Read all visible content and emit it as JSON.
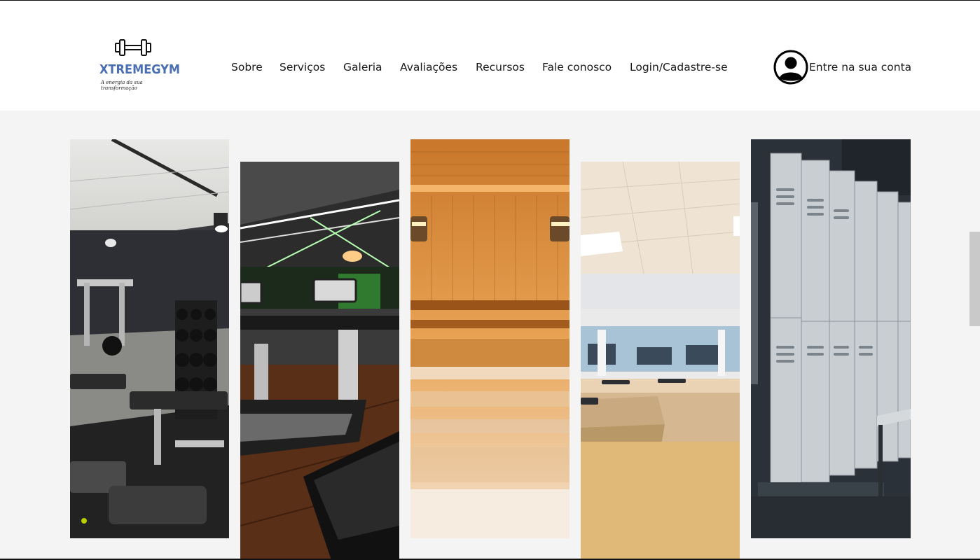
{
  "brand": {
    "name": "XTREMEGYM",
    "tagline": "A energia da sua transformação",
    "accent": "#4a6fb0"
  },
  "nav": {
    "items": [
      {
        "label": "Sobre"
      },
      {
        "label": "Serviços"
      },
      {
        "label": "Galeria"
      },
      {
        "label": "Avaliações"
      },
      {
        "label": "Recursos"
      },
      {
        "label": "Fale conosco"
      },
      {
        "label": "Login/Cadastre-se"
      }
    ]
  },
  "account": {
    "label": "Entre na sua conta",
    "icon": "user-circle-icon"
  },
  "gallery": {
    "photos": [
      {
        "subject": "weight-room",
        "icon": "photo-icon"
      },
      {
        "subject": "treadmills",
        "icon": "photo-icon"
      },
      {
        "subject": "sauna",
        "icon": "photo-icon"
      },
      {
        "subject": "studio",
        "icon": "photo-icon"
      },
      {
        "subject": "lockers",
        "icon": "photo-icon"
      }
    ]
  }
}
